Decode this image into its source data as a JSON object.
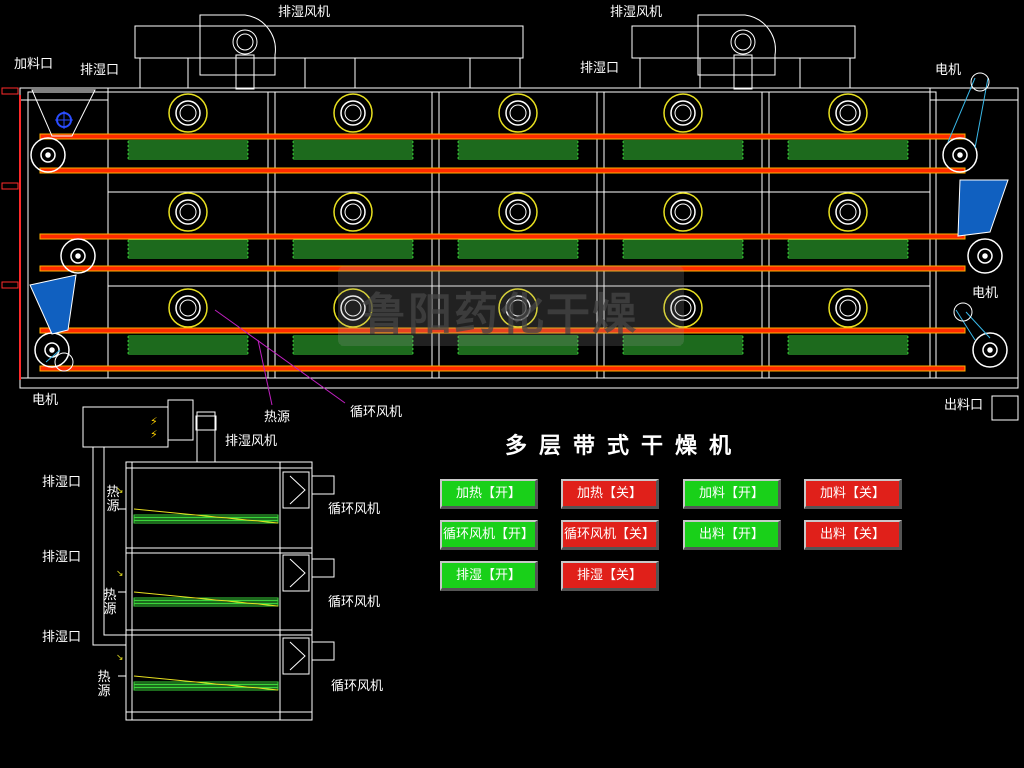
{
  "title": "多层带式干燥机",
  "labels": {
    "exhaust_fan_1": "排湿风机",
    "exhaust_fan_2": "排湿风机",
    "feed_port": "加料口",
    "exhaust_port_1": "排湿口",
    "exhaust_port_2": "排湿口",
    "motor_tr": "电机",
    "motor_r": "电机",
    "motor_bl": "电机",
    "heat_source": "热源",
    "circ_fan": "循环风机",
    "discharge_port": "出料口"
  },
  "side": {
    "exhaust_fan": "排湿风机",
    "exhaust_ports": [
      "排湿口",
      "排湿口",
      "排湿口"
    ],
    "heat_sources": [
      "热源",
      "热源",
      "热源"
    ],
    "circ_fans": [
      "循环风机",
      "循环风机",
      "循环风机"
    ]
  },
  "buttons": {
    "heat_on": "加热【开】",
    "heat_off": "加热【关】",
    "feed_on": "加料【开】",
    "feed_off": "加料【关】",
    "circ_on": "循环风机【开】",
    "circ_off": "循环风机【关】",
    "discharge_on": "出料【开】",
    "discharge_off": "出料【关】",
    "exhaust_on": "排湿【开】",
    "exhaust_off": "排湿【关】"
  },
  "watermark": "鲁阳药化干燥",
  "colors": {
    "on": "#19d019",
    "off": "#e0201a",
    "belt": "#ff2a00",
    "belt_edge": "#ffb000",
    "heater": "#3ad43a",
    "fan": "#e8e020",
    "hopper": "#1060c0"
  }
}
